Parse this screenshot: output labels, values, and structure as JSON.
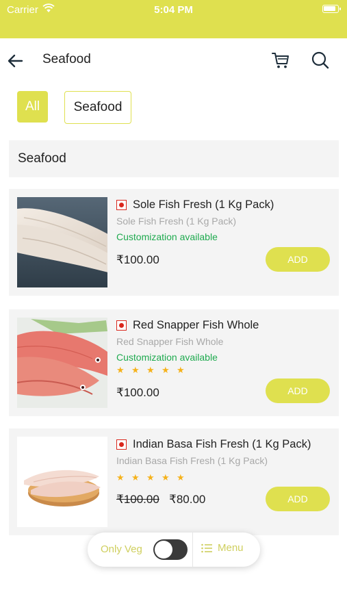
{
  "status_bar": {
    "carrier": "Carrier",
    "time": "5:04 PM"
  },
  "nav": {
    "title": "Seafood"
  },
  "filters": [
    {
      "label": "All",
      "active": true
    },
    {
      "label": "Seafood",
      "active": false
    }
  ],
  "section": {
    "title": "Seafood"
  },
  "products": [
    {
      "name": "Sole Fish Fresh (1 Kg Pack)",
      "subtitle": "Sole Fish Fresh (1 Kg Pack)",
      "customization": "Customization available",
      "rating": 0,
      "price": "₹100.00",
      "add_label": "ADD"
    },
    {
      "name": "Red Snapper Fish Whole",
      "subtitle": "Red Snapper Fish Whole",
      "customization": "Customization available",
      "rating": 5,
      "price": "₹100.00",
      "add_label": "ADD"
    },
    {
      "name": "Indian Basa Fish Fresh (1 Kg Pack)",
      "subtitle": "Indian Basa Fish Fresh (1 Kg Pack)",
      "rating": 5,
      "old_price": "₹100.00",
      "price": "₹80.00",
      "add_label": "ADD"
    }
  ],
  "bottom_bar": {
    "only_veg_label": "Only Veg",
    "only_veg_on": false,
    "menu_label": "Menu"
  },
  "colors": {
    "accent": "#dfe04f",
    "customization": "#1faa4f",
    "nonveg_mark": "#d9261c",
    "star": "#f5b21b"
  }
}
